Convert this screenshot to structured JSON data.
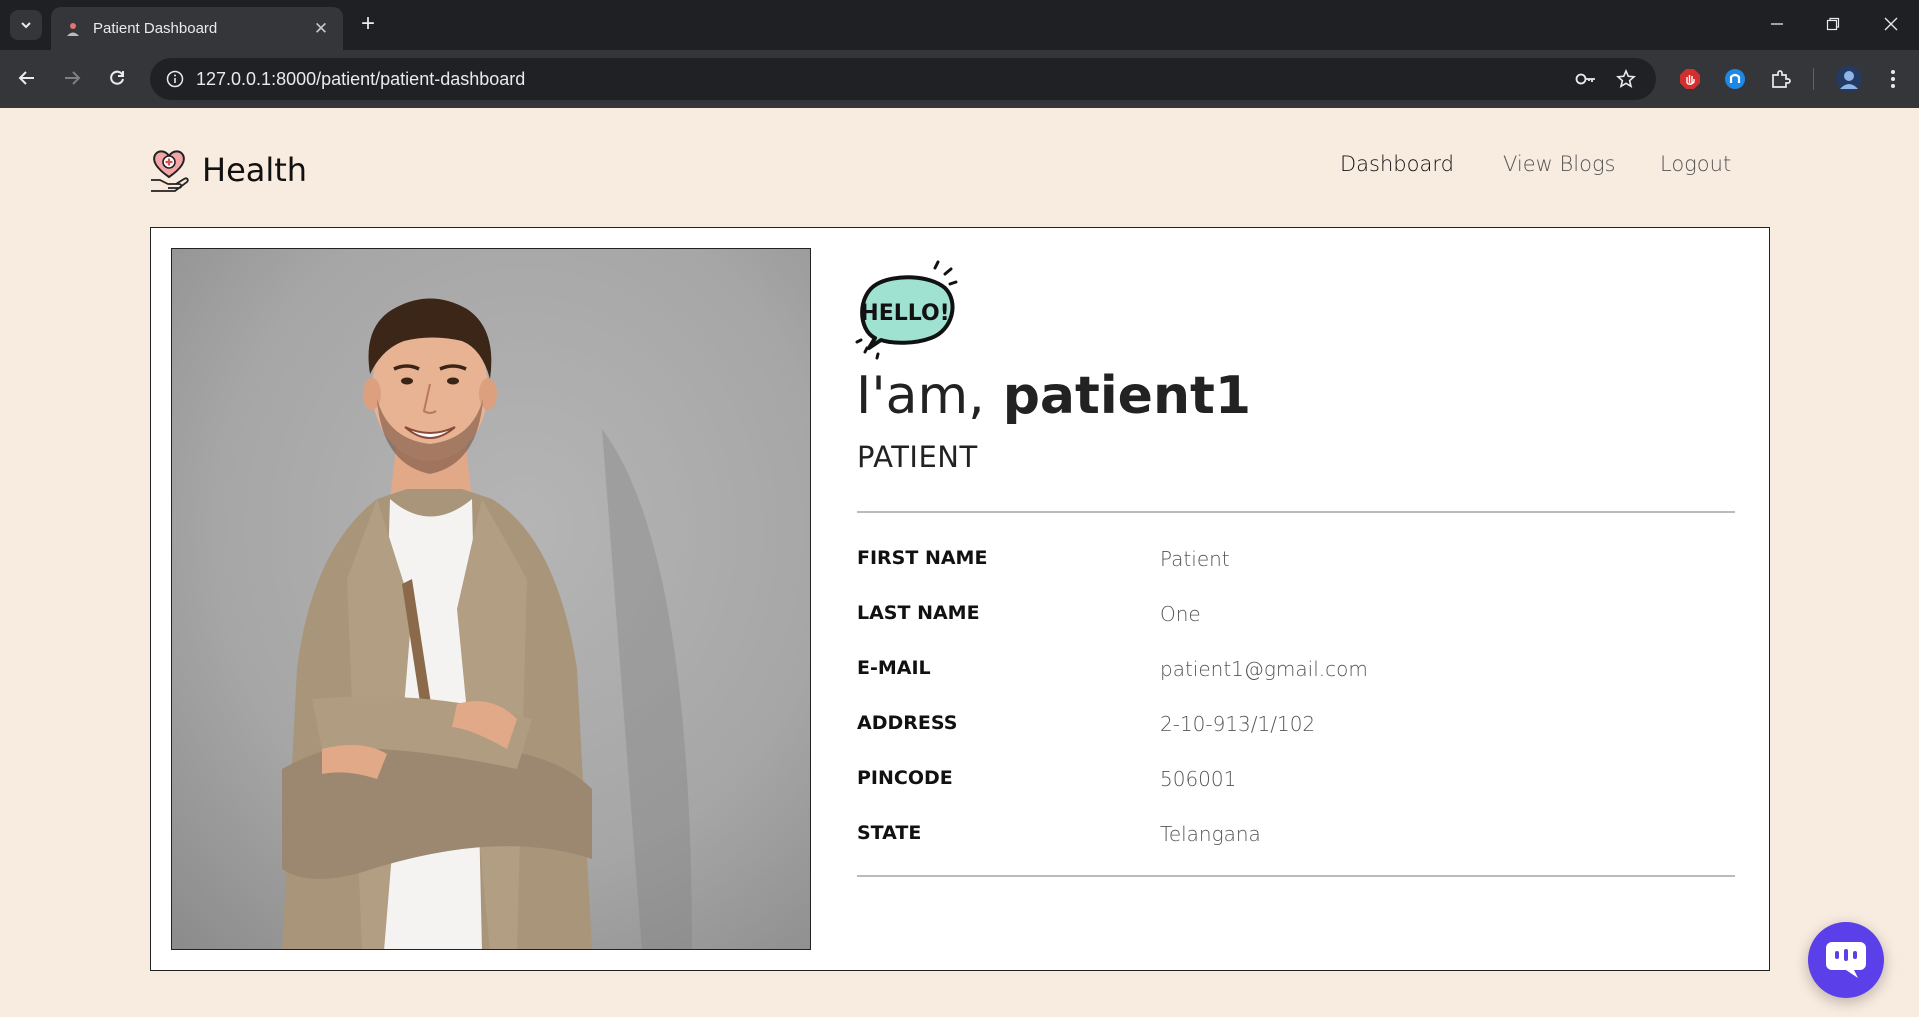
{
  "browser": {
    "tab_title": "Patient Dashboard",
    "url": "127.0.0.1:8000/patient/patient-dashboard"
  },
  "site": {
    "brand": "Health",
    "nav": [
      {
        "label": "Dashboard",
        "active": true
      },
      {
        "label": "View Blogs",
        "active": false
      },
      {
        "label": "Logout",
        "active": false
      }
    ]
  },
  "profile": {
    "hello_badge": "HELLO!",
    "greeting_prefix": "I'am,",
    "username": "patient1",
    "role": "PATIENT",
    "fields": [
      {
        "label": "FIRST NAME",
        "value": "Patient"
      },
      {
        "label": "LAST NAME",
        "value": "One"
      },
      {
        "label": "E-MAIL",
        "value": "patient1@gmail.com"
      },
      {
        "label": "ADDRESS",
        "value": "2-10-913/1/102"
      },
      {
        "label": "PINCODE",
        "value": "506001"
      },
      {
        "label": "STATE",
        "value": "Telangana"
      }
    ]
  },
  "colors": {
    "page_bg": "#f8ebe0",
    "hello_bubble": "#9fe2d1",
    "chat_fab": "#5b3fe8"
  },
  "icons": {
    "chat_fab": "chat-bubble-icon",
    "logo": "heart-hand-icon"
  }
}
